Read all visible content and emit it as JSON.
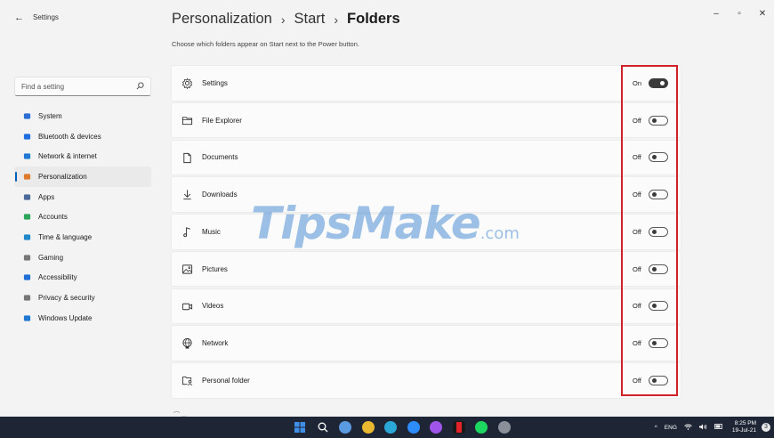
{
  "window": {
    "app_title": "Settings",
    "controls": {
      "minimize": "–",
      "maximize": "▫",
      "close": "✕"
    }
  },
  "search": {
    "placeholder": "Find a setting"
  },
  "sidebar": {
    "items": [
      {
        "label": "System",
        "icon": "monitor-icon",
        "color": "#2b6fd6"
      },
      {
        "label": "Bluetooth & devices",
        "icon": "bluetooth-icon",
        "color": "#1d6fe0"
      },
      {
        "label": "Network & internet",
        "icon": "wifi-icon",
        "color": "#1f78d1"
      },
      {
        "label": "Personalization",
        "icon": "brush-icon",
        "color": "#e07a2b",
        "active": true
      },
      {
        "label": "Apps",
        "icon": "apps-icon",
        "color": "#4a6a9a"
      },
      {
        "label": "Accounts",
        "icon": "person-icon",
        "color": "#2aa55a"
      },
      {
        "label": "Time & language",
        "icon": "globe-clock-icon",
        "color": "#1f88c9"
      },
      {
        "label": "Gaming",
        "icon": "controller-icon",
        "color": "#777777"
      },
      {
        "label": "Accessibility",
        "icon": "accessibility-icon",
        "color": "#1f6fd6"
      },
      {
        "label": "Privacy & security",
        "icon": "shield-icon",
        "color": "#777777"
      },
      {
        "label": "Windows Update",
        "icon": "update-icon",
        "color": "#1f78d1"
      }
    ]
  },
  "breadcrumb": {
    "part1": "Personalization",
    "part2": "Start",
    "current": "Folders",
    "separator": "›"
  },
  "subtitle": "Choose which folders appear on Start next to the Power button.",
  "folders": [
    {
      "label": "Settings",
      "icon": "gear-icon",
      "state": "On",
      "on": true
    },
    {
      "label": "File Explorer",
      "icon": "folder-icon",
      "state": "Off",
      "on": false
    },
    {
      "label": "Documents",
      "icon": "document-icon",
      "state": "Off",
      "on": false
    },
    {
      "label": "Downloads",
      "icon": "download-icon",
      "state": "Off",
      "on": false
    },
    {
      "label": "Music",
      "icon": "music-note-icon",
      "state": "Off",
      "on": false
    },
    {
      "label": "Pictures",
      "icon": "picture-icon",
      "state": "Off",
      "on": false
    },
    {
      "label": "Videos",
      "icon": "video-icon",
      "state": "Off",
      "on": false
    },
    {
      "label": "Network",
      "icon": "network-globe-icon",
      "state": "Off",
      "on": false
    },
    {
      "label": "Personal folder",
      "icon": "personal-folder-icon",
      "state": "Off",
      "on": false
    }
  ],
  "watermark": {
    "text": "TipsMake",
    "suffix": ".com"
  },
  "taskbar": {
    "apps": [
      {
        "name": "start-icon",
        "color": "#3f8ee8"
      },
      {
        "name": "search-icon",
        "color": "#1e2636"
      },
      {
        "name": "task-view-icon",
        "color": "#5a9ae0"
      },
      {
        "name": "chrome-icon",
        "color": "#e8b830"
      },
      {
        "name": "edge-icon",
        "color": "#2aa7d6"
      },
      {
        "name": "zoom-icon",
        "color": "#2d8cff"
      },
      {
        "name": "messenger-icon",
        "color": "#a055e8"
      },
      {
        "name": "app-red-icon",
        "color": "#1a1a1a"
      },
      {
        "name": "spotify-icon",
        "color": "#1ed760"
      },
      {
        "name": "settings-app-icon",
        "color": "#8a8f9a"
      }
    ],
    "tray": {
      "chevron": "^",
      "lang": "ENG",
      "time": "8:25 PM",
      "date": "19-Jul-21"
    }
  }
}
